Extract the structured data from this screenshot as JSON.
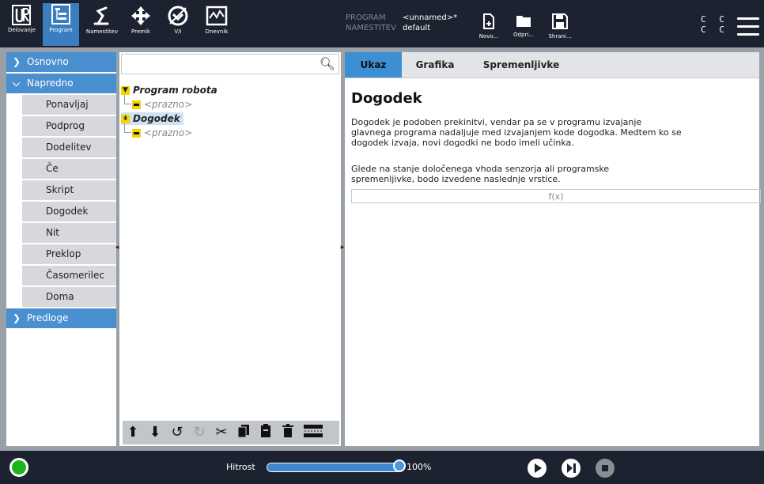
{
  "topbar": {
    "nav": [
      {
        "label": "Delovanje",
        "icon": "ur-logo-icon"
      },
      {
        "label": "Program",
        "icon": "program-icon",
        "active": true
      },
      {
        "label": "Namestitev",
        "icon": "installation-icon"
      },
      {
        "label": "Premik",
        "icon": "move-icon"
      },
      {
        "label": "V/I",
        "icon": "io-icon"
      },
      {
        "label": "Dnevnik",
        "icon": "log-icon"
      }
    ],
    "program_key": "PROGRAM",
    "program_value": "<unnamed>*",
    "installation_key": "NAMESTITEV",
    "installation_value": "default",
    "file": {
      "new": "Novo...",
      "open": "Odpri...",
      "save": "Shrani..."
    },
    "cc_line1": "C C",
    "cc_line2": "C C"
  },
  "sidebar": {
    "cat_basic": "Osnovno",
    "cat_advanced": "Napredno",
    "items": [
      "Ponavljaj",
      "Podprog",
      "Dodelitev",
      "Če",
      "Skript",
      "Dogodek",
      "Nit",
      "Preklop",
      "Časomerilec",
      "Doma"
    ],
    "cat_templates": "Predloge"
  },
  "tree": {
    "search_placeholder": "",
    "root": "Program robota",
    "empty1": "<prazno>",
    "event": "Dogodek",
    "empty2": "<prazno>"
  },
  "panel": {
    "tabs": [
      "Ukaz",
      "Grafika",
      "Spremenljivke"
    ],
    "title": "Dogodek",
    "desc1": "Dogodek je podoben prekinitvi, vendar pa se v programu izvajanje glavnega programa nadaljuje med izvajanjem kode dogodka. Medtem ko se dogodek izvaja, novi dogodki ne bodo imeli učinka.",
    "desc2": "Glede na stanje določenega vhoda senzorja ali programske spremenljivke, bodo izvedene naslednje vrstice.",
    "fx": "f(x)"
  },
  "footer": {
    "speed_label": "Hitrost",
    "speed_value": "100%",
    "speed_fraction": 1.0
  },
  "colors": {
    "topbar": "#1c2230",
    "accent": "#3a7ec1",
    "category": "#4a8fd0",
    "status_ok": "#1db31d"
  }
}
